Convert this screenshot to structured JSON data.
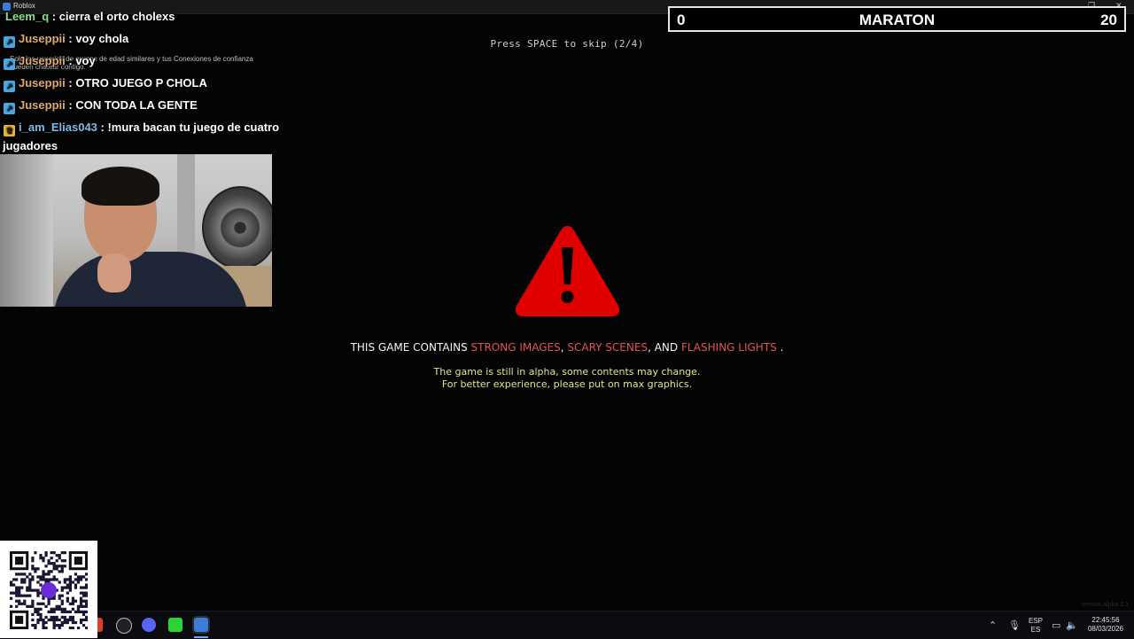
{
  "window": {
    "title": "Roblox"
  },
  "scoreboard": {
    "left_score": "0",
    "title": "MARATON",
    "right_score": "20"
  },
  "game": {
    "skip_hint": "Press SPACE to skip (2/4)",
    "warning_prefix": "THIS GAME CONTAINS ",
    "highlight_1": "STRONG IMAGES",
    "sep_1": ", ",
    "highlight_2": "SCARY SCENES",
    "sep_2": ", AND ",
    "highlight_3": "FLASHING LIGHTS",
    "suffix": " .",
    "alpha_notice": "The game is still in alpha, some contents may change.",
    "graphics_notice": "For better experience, please put on max graphics.",
    "version": "version alpha 2.1",
    "colors": {
      "warning_red": "#e00000",
      "highlight": "#e05454",
      "notice_yellow": "#e4e48e"
    }
  },
  "roblox_notice": "Solo los usuarios de grupos de edad similares y tus Conexiones de confianza pueden chatear contigo.",
  "chat": [
    {
      "user": "Leem_q",
      "sep": " : ",
      "message": "cierra el orto cholexs",
      "badge": "none"
    },
    {
      "user": "Juseppii",
      "sep": " : ",
      "message": "voy chola",
      "badge": "blue"
    },
    {
      "user": "Juseppii",
      "sep": " : ",
      "message": "voy",
      "badge": "blue"
    },
    {
      "user": "Juseppii",
      "sep": " : ",
      "message": "OTRO JUEGO P CHOLA",
      "badge": "blue"
    },
    {
      "user": "Juseppii",
      "sep": " : ",
      "message": "CON TODA LA GENTE",
      "badge": "blue"
    },
    {
      "user": "i_am_Elias043",
      "sep": " : ",
      "message": "!mura bacan tu juego de cuatro",
      "badge": "gold"
    },
    {
      "message": "jugadores"
    }
  ],
  "taskbar": {
    "apps": [
      "brave-icon",
      "obs-icon",
      "discord-icon",
      "kick-icon",
      "roblox-icon"
    ],
    "language": {
      "line1": "ESP",
      "line2": "ES"
    },
    "time": "22:45:56",
    "date": "08/03/2026"
  }
}
